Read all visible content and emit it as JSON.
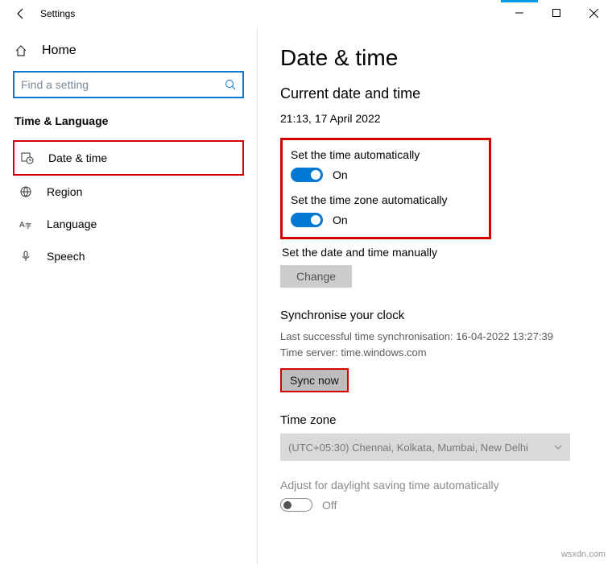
{
  "window": {
    "title": "Settings"
  },
  "sidebar": {
    "home": "Home",
    "search_placeholder": "Find a setting",
    "section": "Time & Language",
    "items": [
      {
        "label": "Date & time"
      },
      {
        "label": "Region"
      },
      {
        "label": "Language"
      },
      {
        "label": "Speech"
      }
    ]
  },
  "main": {
    "title": "Date & time",
    "current_heading": "Current date and time",
    "current_value": "21:13, 17 April 2022",
    "auto_time_label": "Set the time automatically",
    "auto_time_state": "On",
    "auto_tz_label": "Set the time zone automatically",
    "auto_tz_state": "On",
    "manual_label": "Set the date and time manually",
    "change_btn": "Change",
    "sync_heading": "Synchronise your clock",
    "sync_last": "Last successful time synchronisation: 16-04-2022 13:27:39",
    "sync_server": "Time server: time.windows.com",
    "sync_btn": "Sync now",
    "tz_heading": "Time zone",
    "tz_value": "(UTC+05:30) Chennai, Kolkata, Mumbai, New Delhi",
    "dst_label": "Adjust for daylight saving time automatically",
    "dst_state": "Off"
  },
  "watermark": "wsxdn.com"
}
